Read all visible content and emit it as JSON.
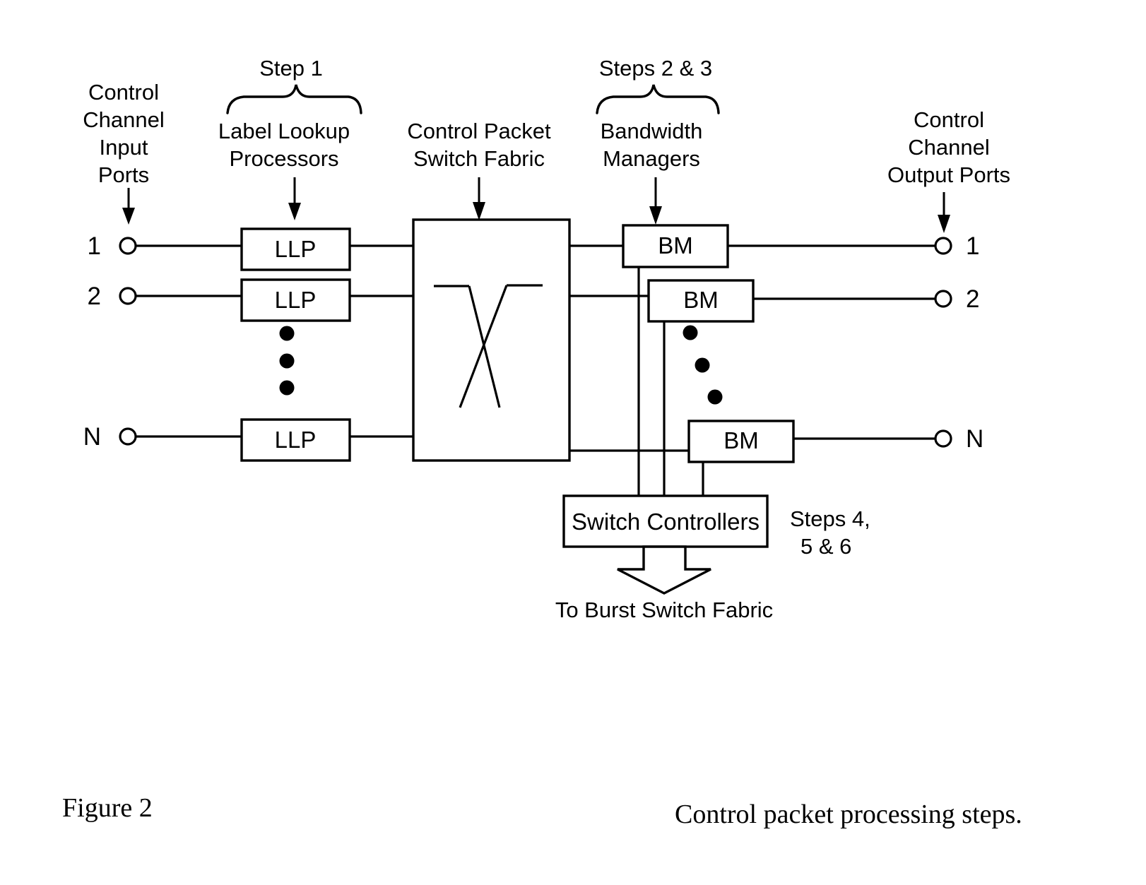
{
  "figure": {
    "number_label": "Figure 2",
    "caption": "Control packet processing steps."
  },
  "annotations": {
    "step1": "Step 1",
    "steps23": "Steps 2 & 3",
    "steps456_line1": "Steps 4,",
    "steps456_line2": "5 & 6"
  },
  "labels": {
    "input_ports": {
      "line1": "Control",
      "line2": "Channel",
      "line3": "Input",
      "line4": "Ports"
    },
    "llp_group": {
      "line1": "Label Lookup",
      "line2": "Processors"
    },
    "fabric_group": {
      "line1": "Control Packet",
      "line2": "Switch Fabric"
    },
    "bm_group": {
      "line1": "Bandwidth",
      "line2": "Managers"
    },
    "output_ports": {
      "line1": "Control",
      "line2": "Channel",
      "line3": "Output Ports"
    }
  },
  "blocks": {
    "llp": [
      {
        "label": "LLP"
      },
      {
        "label": "LLP"
      },
      {
        "label": "LLP"
      }
    ],
    "bm": [
      {
        "label": "BM"
      },
      {
        "label": "BM"
      },
      {
        "label": "BM"
      }
    ],
    "switch_controllers": {
      "label": "Switch Controllers"
    },
    "burst_arrow": {
      "label": "To Burst Switch Fabric"
    }
  },
  "ports": {
    "input": [
      {
        "number": "1"
      },
      {
        "number": "2"
      },
      {
        "number": "N"
      }
    ],
    "output": [
      {
        "number": "1"
      },
      {
        "number": "2"
      },
      {
        "number": "N"
      }
    ]
  },
  "colors": {
    "ink": "#000000",
    "paper": "#ffffff"
  }
}
